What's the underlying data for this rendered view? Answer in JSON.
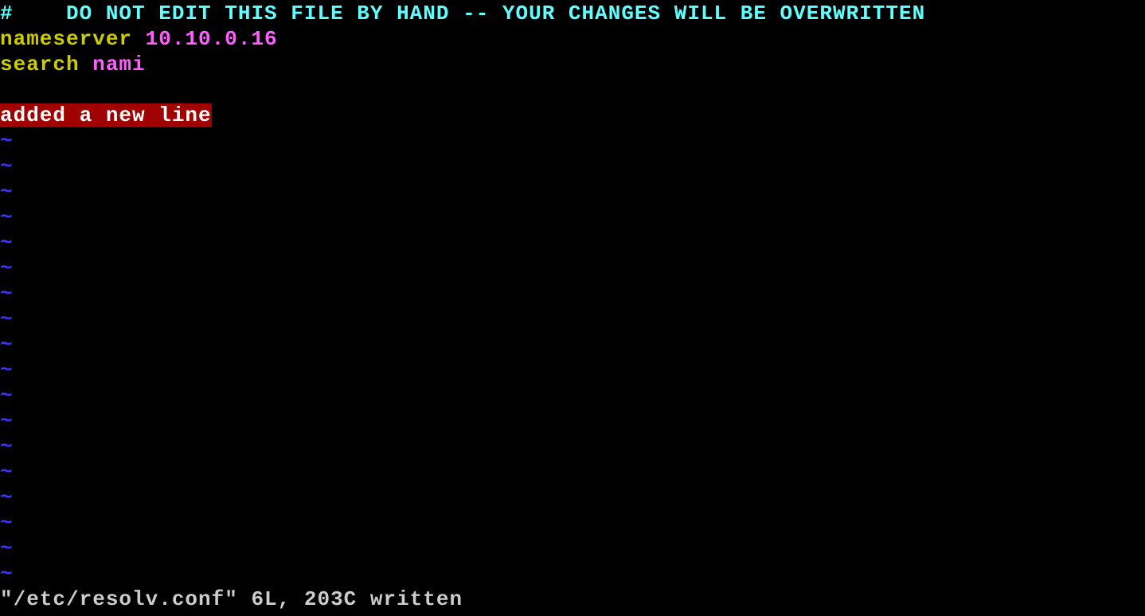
{
  "editor": {
    "lines": {
      "line1_hash": "#",
      "line1_comment": "    DO NOT EDIT THIS FILE BY HAND -- YOUR CHANGES WILL BE OVERWRITTEN",
      "line2_keyword": "nameserver",
      "line2_value": " 10.10.0.16",
      "line3_keyword": "search",
      "line3_value": " nami",
      "line5_error": "added a new line"
    },
    "tilde": "~",
    "status_message": "\"/etc/resolv.conf\" 6L, 203C written"
  }
}
